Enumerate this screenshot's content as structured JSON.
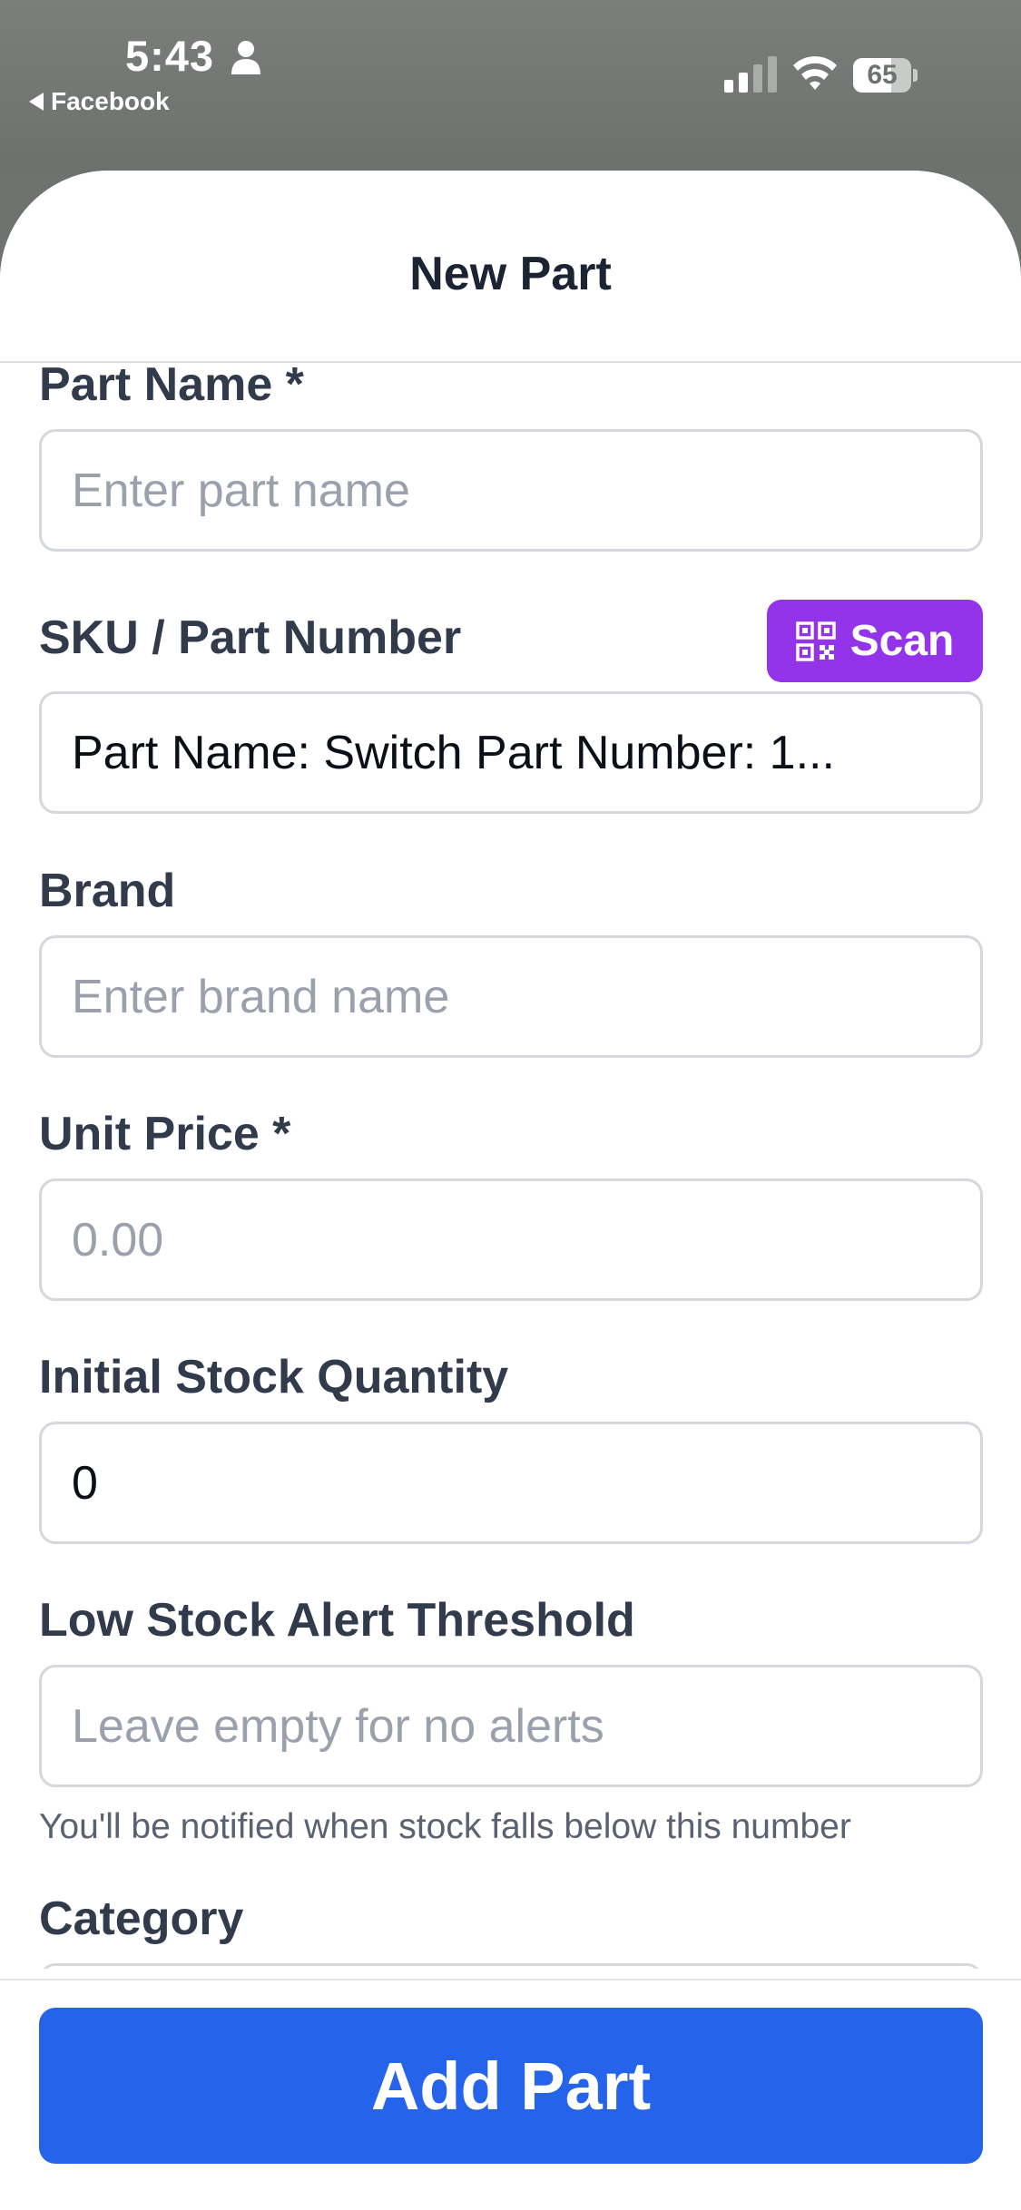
{
  "status_bar": {
    "time": "5:43",
    "back_app": "Facebook",
    "battery": "65",
    "battery_level": 0.65
  },
  "sheet": {
    "title": "New Part"
  },
  "form": {
    "part_name": {
      "label": "Part Name *",
      "placeholder": "Enter part name"
    },
    "sku": {
      "label": "SKU / Part Number",
      "value": "Part Name: Switch Part Number: 1...",
      "scan_label": "Scan"
    },
    "brand": {
      "label": "Brand",
      "placeholder": "Enter brand name"
    },
    "unit_price": {
      "label": "Unit Price *",
      "placeholder": "0.00"
    },
    "initial_stock": {
      "label": "Initial Stock Quantity",
      "value": "0"
    },
    "low_stock": {
      "label": "Low Stock Alert Threshold",
      "placeholder": "Leave empty for no alerts",
      "hint": "You'll be notified when stock falls below this number"
    },
    "category": {
      "label": "Category"
    }
  },
  "footer": {
    "add_label": "Add Part"
  }
}
